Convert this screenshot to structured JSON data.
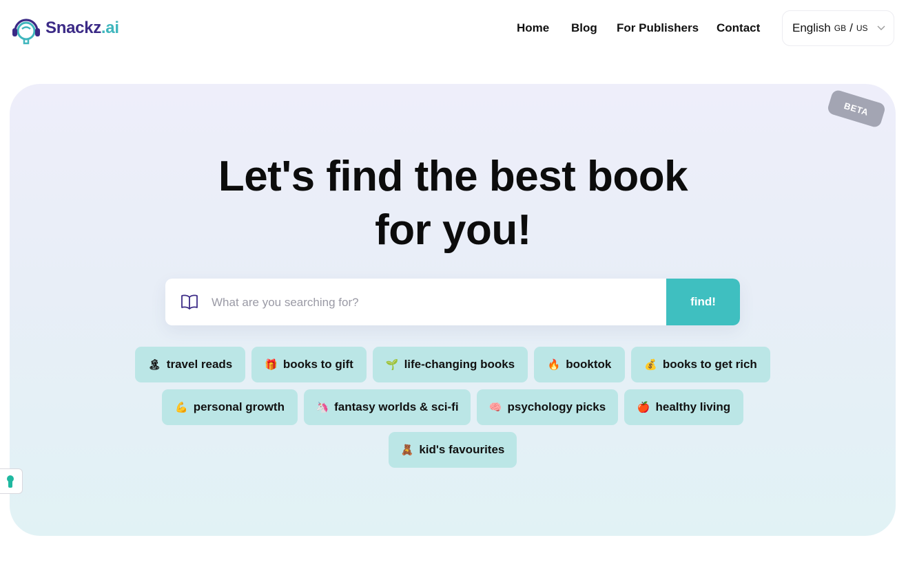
{
  "brand": {
    "name": "Snackz",
    "tld": ".ai"
  },
  "nav": {
    "home": "Home",
    "blog": "Blog",
    "publishers": "For Publishers",
    "contact": "Contact"
  },
  "language": {
    "label": "English",
    "region1": "GB",
    "separator": "/",
    "region2": "US"
  },
  "hero": {
    "badge": "BETA",
    "headline_line1": "Let's find the best book",
    "headline_line2": "for you!"
  },
  "search": {
    "placeholder": "What are you searching for?",
    "button": "find!"
  },
  "chips": [
    {
      "emoji": "🏝",
      "label": "travel reads"
    },
    {
      "emoji": "🎁",
      "label": "books to gift"
    },
    {
      "emoji": "🌱",
      "label": "life-changing books"
    },
    {
      "emoji": "🔥",
      "label": "booktok"
    },
    {
      "emoji": "💰",
      "label": "books to get rich"
    },
    {
      "emoji": "💪",
      "label": "personal growth"
    },
    {
      "emoji": "🦄",
      "label": "fantasy worlds & sci-fi"
    },
    {
      "emoji": "🧠",
      "label": "psychology picks"
    },
    {
      "emoji": "🍎",
      "label": "healthy living"
    },
    {
      "emoji": "🧸",
      "label": "kid's favourites"
    }
  ],
  "colors": {
    "brand_purple": "#3b2a86",
    "accent_teal": "#3fbfc0",
    "chip_bg": "#bbe6e6"
  },
  "icons": {
    "logo": "headphones-head-logo",
    "search": "open-book-icon",
    "accessibility": "keyhole-icon"
  }
}
